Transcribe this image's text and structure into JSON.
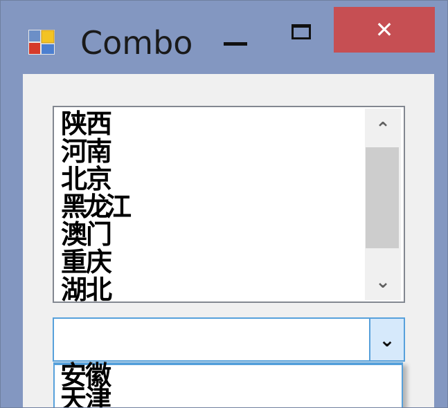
{
  "window": {
    "title": "Combo",
    "icon": "app-icon",
    "close_label": "✕"
  },
  "listbox": {
    "items": [
      "陕西",
      "河南",
      "北京",
      "黑龙江",
      "澳门",
      "重庆",
      "湖北"
    ],
    "scroll_up_icon": "chevron-up-icon",
    "scroll_down_icon": "chevron-down-icon"
  },
  "combo": {
    "value": "",
    "dropdown_icon": "chevron-down-icon"
  },
  "dropdown": {
    "items": [
      "安徽",
      "天津"
    ]
  },
  "colors": {
    "titlebar": "#8397c1",
    "close_button": "#c64f53",
    "client_bg": "#f0f0f0",
    "focus_border": "#56a0db",
    "combo_button": "#d6e9fb",
    "scroll_thumb": "#cdcdcd"
  }
}
